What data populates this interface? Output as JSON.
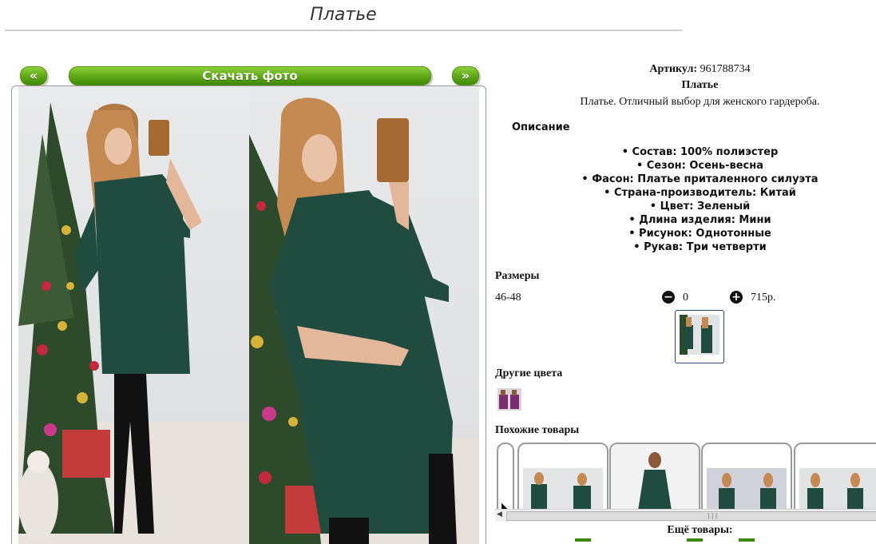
{
  "page": {
    "title": "Платье"
  },
  "gallery": {
    "prev_label": "«",
    "download_label": "Скачать фото",
    "next_label": "»"
  },
  "product": {
    "article_label": "Артикул:",
    "article_value": "961788734",
    "name": "Платье",
    "tagline": "Платье. Отличный выбор для женского гардероба.",
    "description_heading": "Описание",
    "features": [
      "Состав: 100% полиэстер",
      "Сезон: Осень-весна",
      "Фасон: Платье приталенного силуэта",
      "Страна-производитель: Китай",
      "Цвет: Зеленый",
      "Длина изделия: Мини",
      "Рисунок: Однотонные",
      "Рукав: Три четверти"
    ]
  },
  "sizes": {
    "heading": "Размеры",
    "rows": [
      {
        "size": "46-48",
        "minus_icon": "minus-circle-icon",
        "quantity": "0",
        "plus_icon": "plus-circle-icon",
        "price": "715р."
      }
    ]
  },
  "other_colors": {
    "heading": "Другие цвета"
  },
  "similar": {
    "heading": "Похожие товары"
  },
  "more": {
    "heading": "Ещё товары:"
  },
  "colors": {
    "accent_green": "#5ea617",
    "dress_green": "#1f4c3f",
    "frame_border": "#999999"
  }
}
